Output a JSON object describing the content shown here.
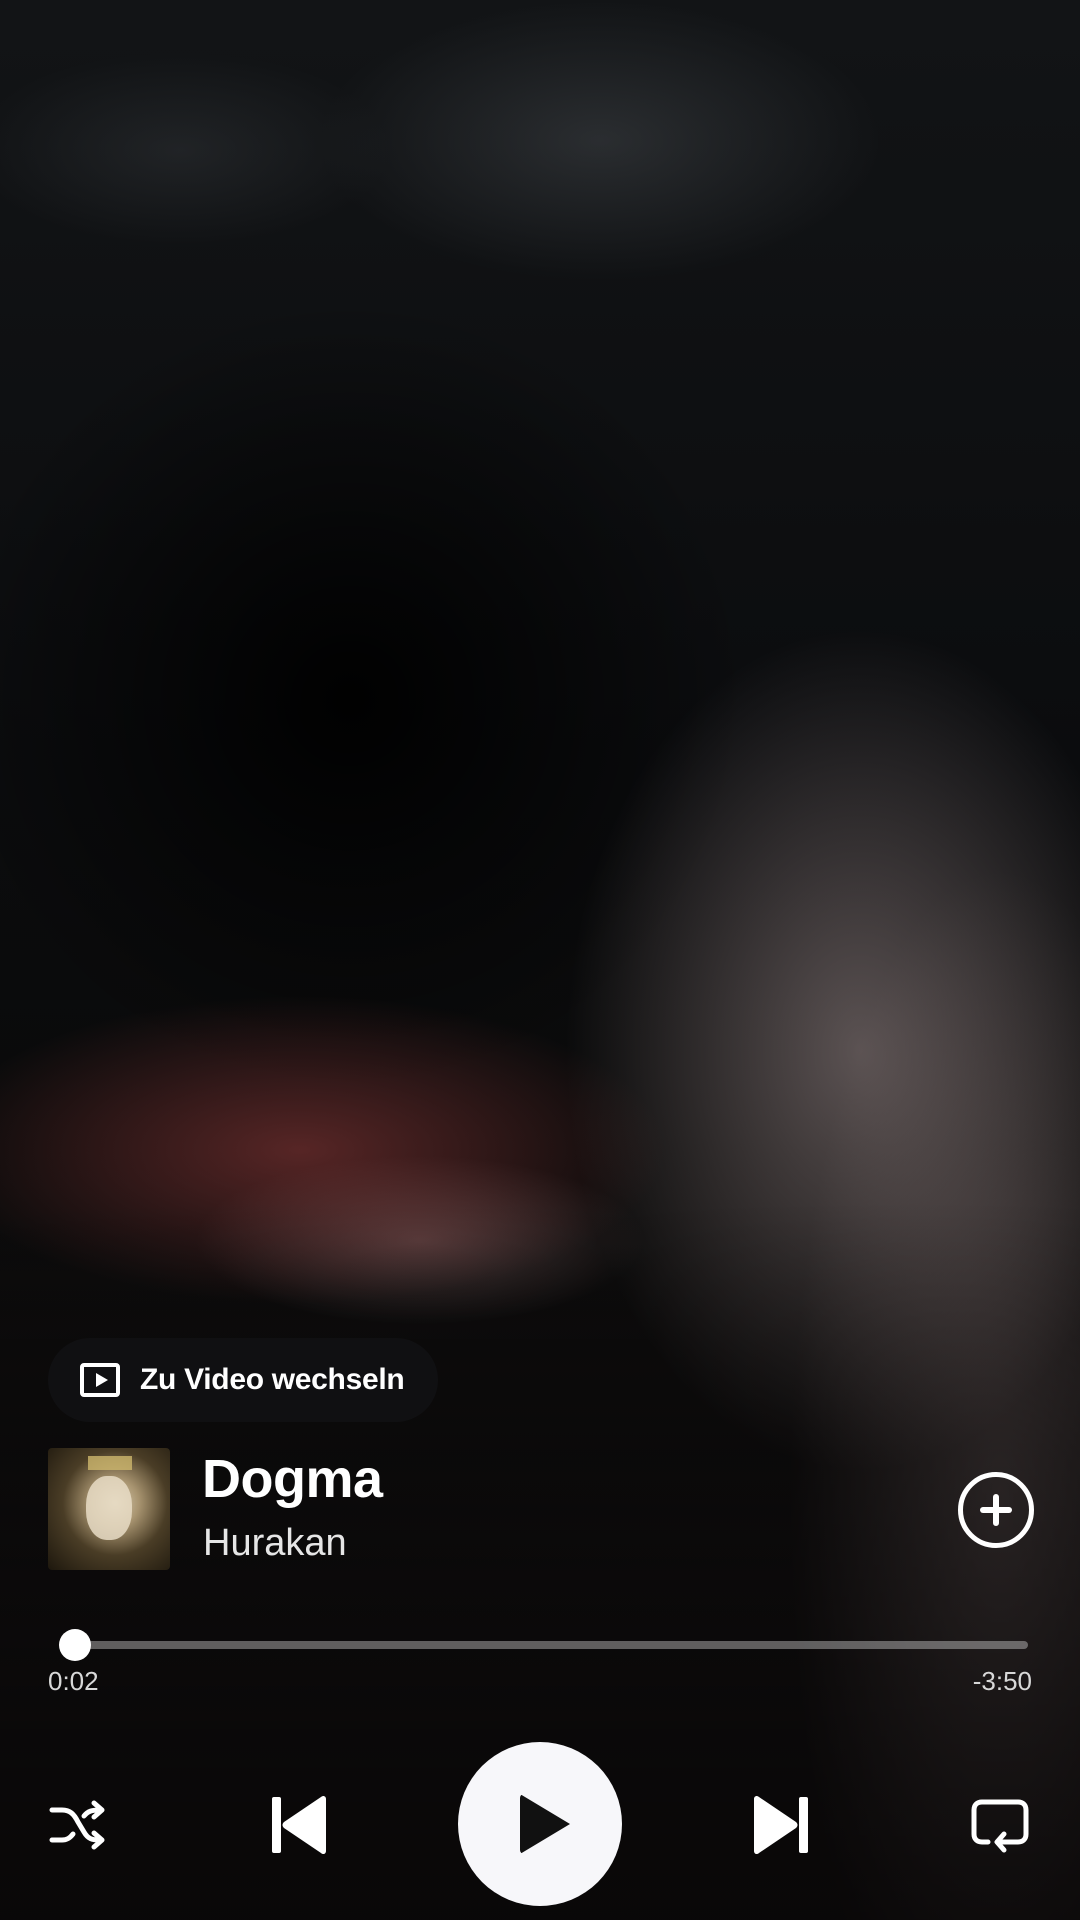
{
  "player": {
    "switch_video_label": "Zu Video wechseln",
    "track": {
      "title": "Dogma",
      "artist": "Hurakan"
    },
    "progress": {
      "elapsed": "0:02",
      "remaining": "-3:50",
      "fraction": 0.009
    },
    "controls": {
      "shuffle_icon": "shuffle-icon",
      "previous_icon": "skip-previous-icon",
      "play_icon": "play-icon",
      "next_icon": "skip-next-icon",
      "repeat_icon": "repeat-icon",
      "add_icon": "add-circle-icon"
    }
  },
  "colors": {
    "accent": "#ffffff",
    "play_button_bg": "#f7f7fa",
    "pill_bg": "#121214"
  }
}
